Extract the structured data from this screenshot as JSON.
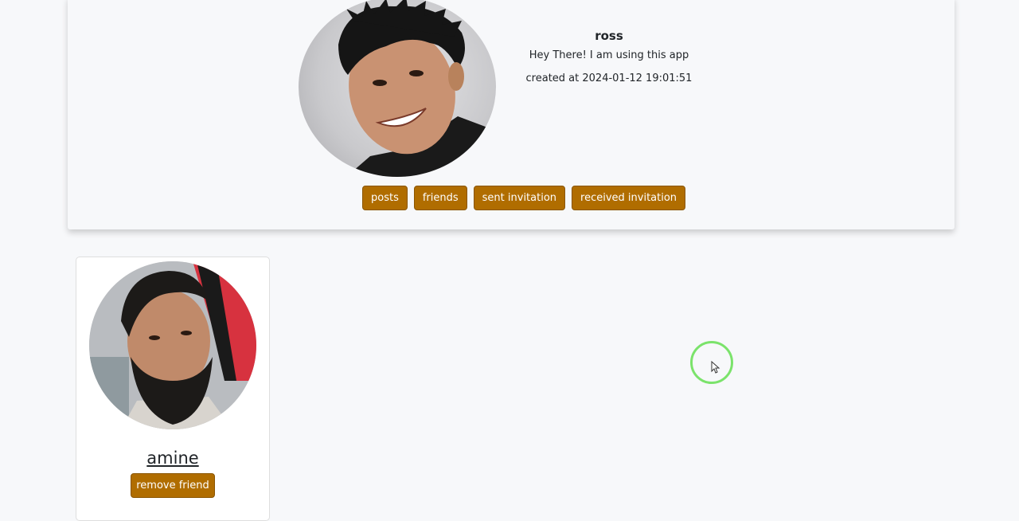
{
  "profile": {
    "name": "ross",
    "bio": "Hey There! I am using this app",
    "created": "created at 2024-01-12 19:01:51",
    "avatar_icon": "user-photo",
    "tabs": [
      {
        "label": "posts"
      },
      {
        "label": "friends"
      },
      {
        "label": "sent invitation"
      },
      {
        "label": "received invitation"
      }
    ]
  },
  "friends": [
    {
      "name": "amine",
      "avatar_icon": "user-photo",
      "remove_label": "remove friend"
    }
  ],
  "colors": {
    "accent": "#b06d00",
    "page_background": "#f7f8fa",
    "cursor_ring": "#7be36b"
  }
}
